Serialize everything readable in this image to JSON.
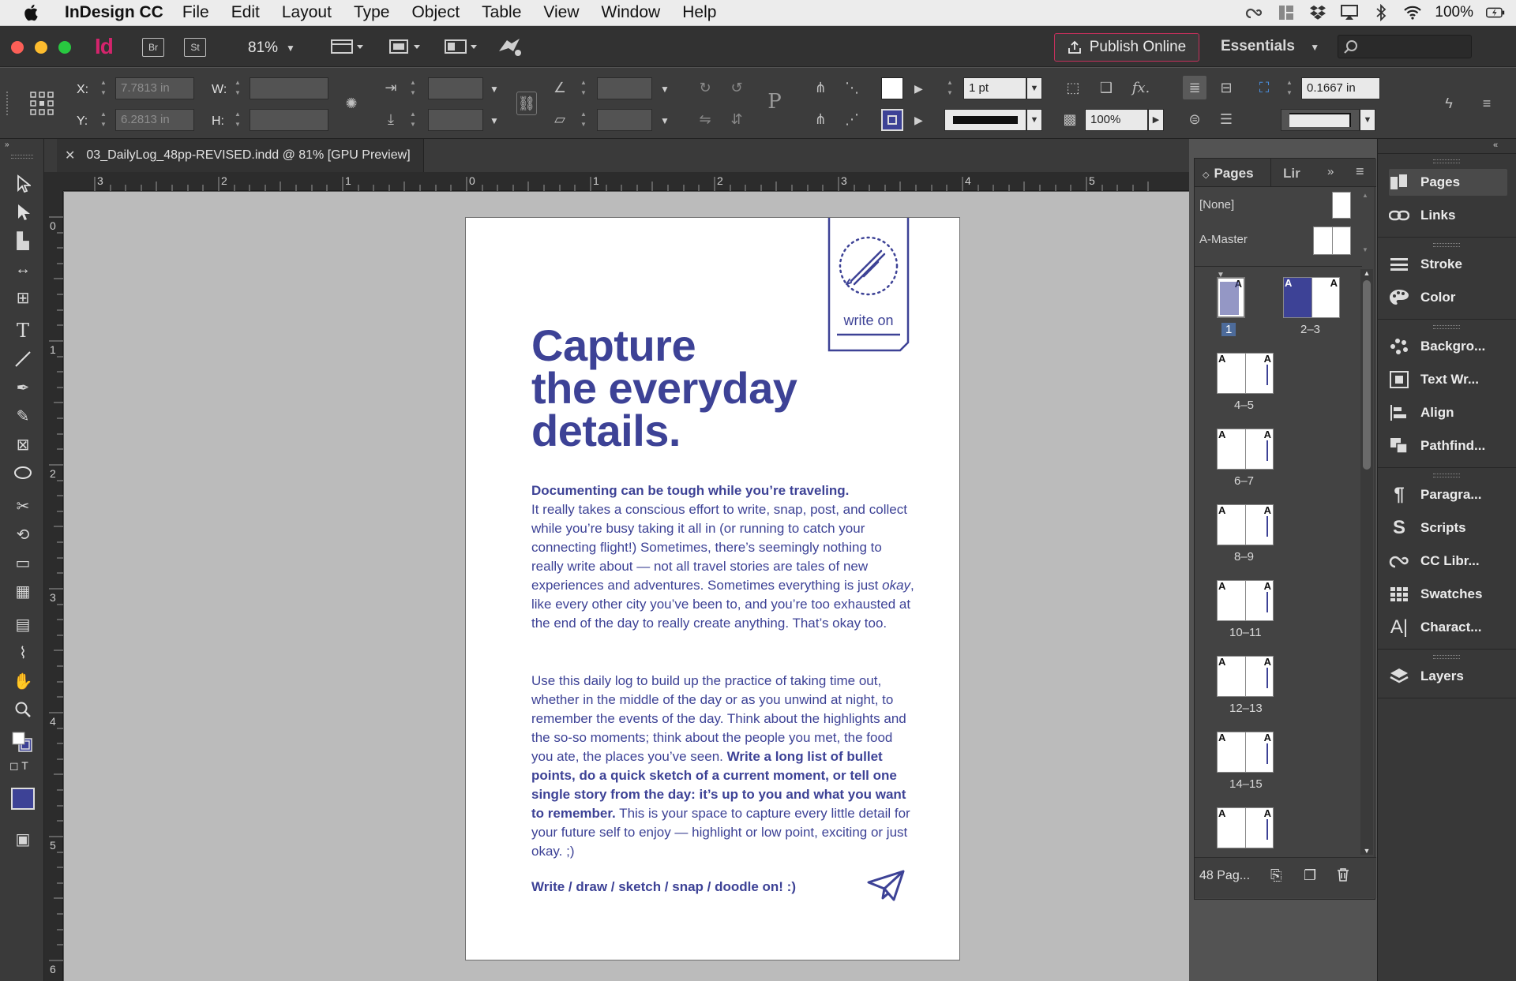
{
  "menubar": {
    "app_name": "InDesign CC",
    "items": [
      "File",
      "Edit",
      "Layout",
      "Type",
      "Object",
      "Table",
      "View",
      "Window",
      "Help"
    ],
    "battery": "100%"
  },
  "appbar": {
    "logo": "Id",
    "bridge": "Br",
    "stock": "St",
    "zoom": "81%",
    "publish_label": "Publish Online",
    "workspace": "Essentials"
  },
  "control": {
    "x_label": "X:",
    "y_label": "Y:",
    "w_label": "W:",
    "h_label": "H:",
    "x_value": "7.7813 in",
    "y_value": "6.2813 in",
    "stroke_weight": "1 pt",
    "opacity": "100%",
    "offset": "0.1667 in"
  },
  "document": {
    "tab_title": "03_DailyLog_48pp-REVISED.indd @ 81% [GPU Preview]",
    "ruler_h": [
      "3",
      "2",
      "1",
      "0",
      "1",
      "2",
      "3",
      "4",
      "5"
    ],
    "ruler_v": [
      "0",
      "1",
      "2",
      "3",
      "4",
      "5",
      "6"
    ]
  },
  "page": {
    "bookmark_text": "write on",
    "headline": [
      "Capture",
      "the everyday",
      "details."
    ],
    "para1_bold": "Documenting can be tough while you’re traveling.",
    "para1_a": "It really takes a conscious effort to write, snap, post, and collect while you’re busy taking it all in (or running to catch your connecting flight!) Sometimes, there’s seemingly nothing to really write about — not all travel stories are tales of new experiences and adventures. Sometimes everything is just ",
    "para1_italic": "okay",
    "para1_b": ", like every other city you’ve been to, and you’re too exhausted at the end of the day to really create anything. That’s okay too.",
    "para2_a": "Use this daily log to build up the practice of taking time out, whether in the middle of the day or as you unwind at night, to remember the events of the day. Think about the highlights and the so-so moments; think about the people you met, the food you ate, the places you’ve seen. ",
    "para2_bold": "Write a long list of bullet points, do a quick sketch of a current moment, or tell one single story from the day: it’s up to you and what you want to remember.",
    "para2_b": " This is your space to capture every little detail for your future self to enjoy — highlight or low point, exciting or just okay. ;)",
    "cta": "Write / draw / sketch / snap / doodle on! :)",
    "ink_color": "#3d4296"
  },
  "pages_panel": {
    "tab_pages": "Pages",
    "tab_links": "Lir",
    "master_none": "[None]",
    "master_a": "A-Master",
    "spreads": [
      "1",
      "2–3",
      "4–5",
      "6–7",
      "8–9",
      "10–11",
      "12–13",
      "14–15"
    ],
    "footer_count": "48 Pag..."
  },
  "dock": {
    "group1": [
      {
        "label": "Pages",
        "icon": "pages-icon"
      },
      {
        "label": "Links",
        "icon": "links-icon"
      }
    ],
    "group2": [
      {
        "label": "Stroke",
        "icon": "stroke-icon"
      },
      {
        "label": "Color",
        "icon": "color-icon"
      }
    ],
    "group3": [
      {
        "label": "Backgro...",
        "icon": "background-tasks-icon"
      },
      {
        "label": "Text Wr...",
        "icon": "text-wrap-icon"
      },
      {
        "label": "Align",
        "icon": "align-icon"
      },
      {
        "label": "Pathfind...",
        "icon": "pathfinder-icon"
      }
    ],
    "group4": [
      {
        "label": "Paragra...",
        "icon": "paragraph-icon"
      },
      {
        "label": "Scripts",
        "icon": "scripts-icon"
      },
      {
        "label": "CC Libr...",
        "icon": "cc-libraries-icon"
      },
      {
        "label": "Swatches",
        "icon": "swatches-icon"
      },
      {
        "label": "Charact...",
        "icon": "character-icon"
      }
    ],
    "group5": [
      {
        "label": "Layers",
        "icon": "layers-icon"
      }
    ]
  }
}
